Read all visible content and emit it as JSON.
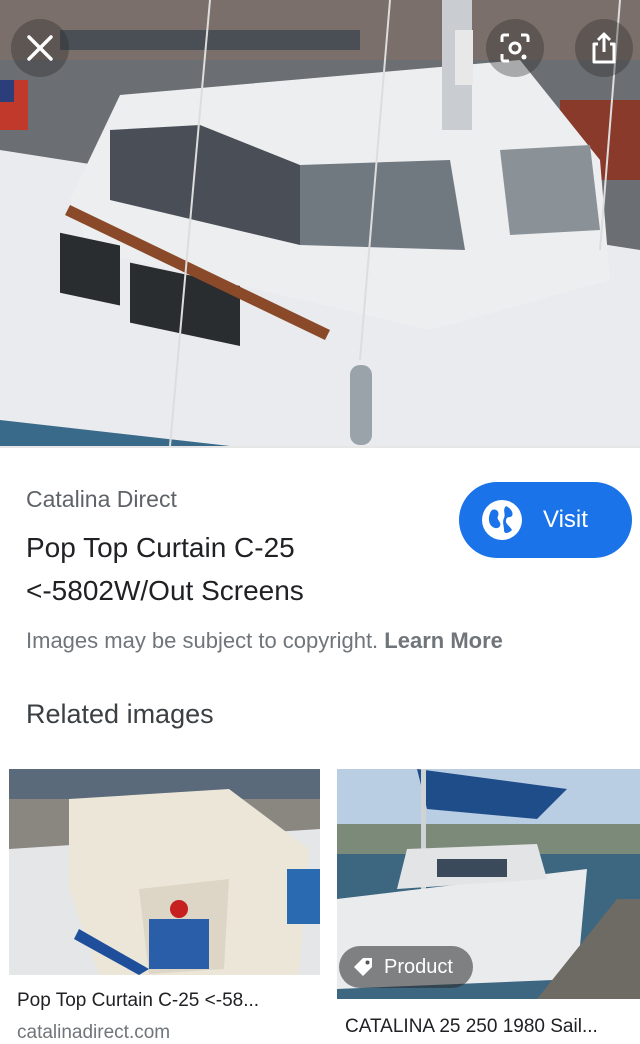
{
  "hero": {
    "close_icon": "close-icon",
    "lens_icon": "lens-icon",
    "share_icon": "share-icon"
  },
  "result": {
    "source": "Catalina Direct",
    "title": "Pop Top Curtain C-25 <-5802W/Out Screens",
    "visit_label": "Visit",
    "visit_color": "#1a73e8"
  },
  "copyright": {
    "text": "Images may be subject to copyright.",
    "learn_more": "Learn More"
  },
  "related": {
    "heading": "Related images",
    "items": [
      {
        "caption": "Pop Top Curtain C-25 <-58...",
        "site": "catalinadirect.com"
      },
      {
        "caption": "CATALINA 25 250 1980 Sail...",
        "badge": "Product"
      }
    ]
  }
}
